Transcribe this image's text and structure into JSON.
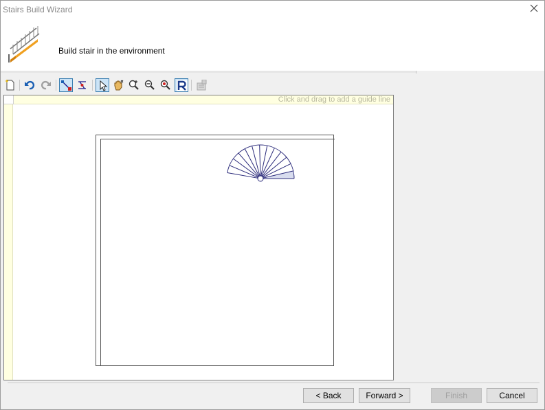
{
  "window": {
    "title": "Stairs Build Wizard"
  },
  "header": {
    "subtitle": "Build stair in the environment"
  },
  "toolbar": {
    "buttons": [
      {
        "name": "new-icon",
        "active": false
      },
      {
        "name": "undo-icon",
        "active": false
      },
      {
        "name": "redo-icon",
        "active": false
      },
      {
        "name": "draw-line-icon",
        "active": true
      },
      {
        "name": "draw-path-icon",
        "active": false
      },
      {
        "name": "select-pointer-icon",
        "active": true
      },
      {
        "name": "pan-hand-icon",
        "active": false
      },
      {
        "name": "zoom-in-icon",
        "active": false
      },
      {
        "name": "zoom-out-icon",
        "active": false
      },
      {
        "name": "zoom-extents-icon",
        "active": false
      },
      {
        "name": "reset-view-icon",
        "active": true
      },
      {
        "name": "properties-icon",
        "active": false
      }
    ]
  },
  "canvas": {
    "guide_hint": "Click and drag to add a guide line"
  },
  "footer": {
    "back_label": "< Back",
    "forward_label": "Forward >",
    "finish_label": "Finish",
    "cancel_label": "Cancel"
  },
  "colors": {
    "stair_stroke": "#2a2a7a",
    "stair_fill_highlight": "#d8dcee",
    "guide_ruler": "#ffffe1",
    "active_tool": "#cce4f7"
  }
}
